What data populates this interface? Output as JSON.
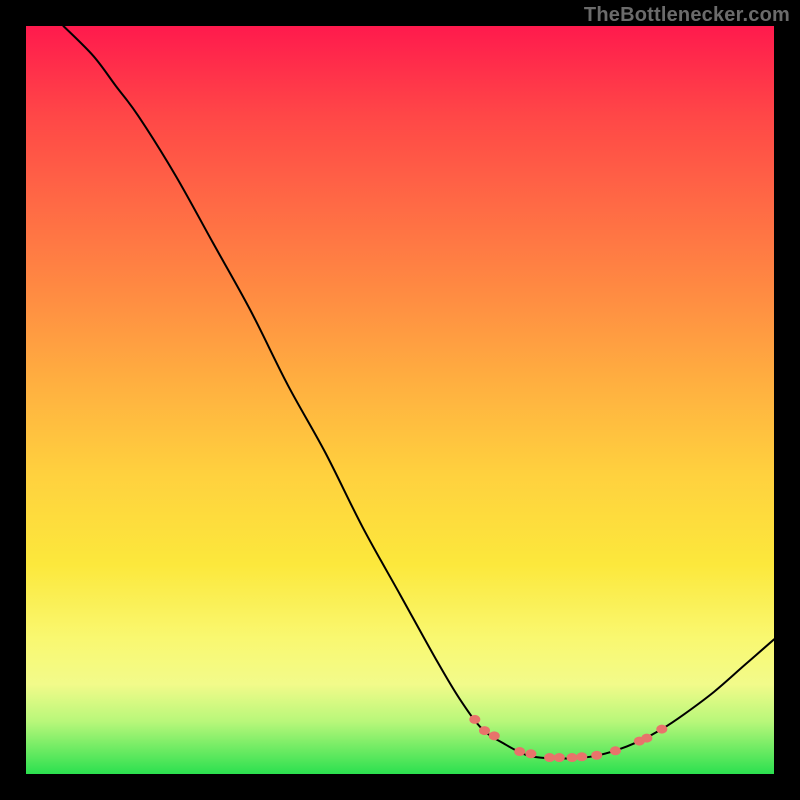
{
  "watermark": "TheBottlenecker.com",
  "chart_data": {
    "type": "line",
    "title": "",
    "xlabel": "",
    "ylabel": "",
    "xlim": [
      0,
      100
    ],
    "ylim": [
      0,
      100
    ],
    "grid": false,
    "line_color": "#000000",
    "dot_color": "#e8736b",
    "background": "gradient_red_to_green",
    "curve": [
      {
        "x": 5,
        "y": 100
      },
      {
        "x": 9,
        "y": 96
      },
      {
        "x": 12,
        "y": 92
      },
      {
        "x": 15,
        "y": 88
      },
      {
        "x": 20,
        "y": 80
      },
      {
        "x": 25,
        "y": 71
      },
      {
        "x": 30,
        "y": 62
      },
      {
        "x": 35,
        "y": 52
      },
      {
        "x": 40,
        "y": 43
      },
      {
        "x": 45,
        "y": 33
      },
      {
        "x": 50,
        "y": 24
      },
      {
        "x": 55,
        "y": 15
      },
      {
        "x": 58,
        "y": 10
      },
      {
        "x": 61,
        "y": 6
      },
      {
        "x": 64,
        "y": 4
      },
      {
        "x": 67,
        "y": 2.5
      },
      {
        "x": 70,
        "y": 2.1
      },
      {
        "x": 73,
        "y": 2.1
      },
      {
        "x": 76,
        "y": 2.4
      },
      {
        "x": 79,
        "y": 3.2
      },
      {
        "x": 82,
        "y": 4.4
      },
      {
        "x": 85,
        "y": 6.0
      },
      {
        "x": 88,
        "y": 8.0
      },
      {
        "x": 92,
        "y": 11.0
      },
      {
        "x": 96,
        "y": 14.5
      },
      {
        "x": 100,
        "y": 18.0
      }
    ],
    "dots": [
      {
        "x": 60,
        "y": 7.3
      },
      {
        "x": 61.3,
        "y": 5.8
      },
      {
        "x": 62.6,
        "y": 5.1
      },
      {
        "x": 66,
        "y": 3.0
      },
      {
        "x": 67.5,
        "y": 2.7
      },
      {
        "x": 70,
        "y": 2.2
      },
      {
        "x": 71.3,
        "y": 2.2
      },
      {
        "x": 73,
        "y": 2.2
      },
      {
        "x": 74.3,
        "y": 2.3
      },
      {
        "x": 76.3,
        "y": 2.5
      },
      {
        "x": 78.8,
        "y": 3.1
      },
      {
        "x": 82,
        "y": 4.4
      },
      {
        "x": 83,
        "y": 4.8
      },
      {
        "x": 85,
        "y": 6.0
      }
    ]
  }
}
